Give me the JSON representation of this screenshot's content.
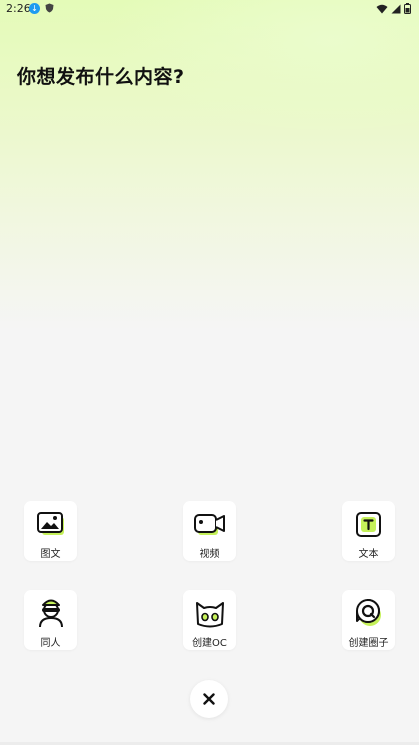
{
  "status_bar": {
    "time": "2:26",
    "badge_glyph": "↓"
  },
  "title": "你想发布什么内容?",
  "items": [
    {
      "label": "图文",
      "icon": "image-icon"
    },
    {
      "label": "视频",
      "icon": "video-icon"
    },
    {
      "label": "文本",
      "icon": "text-icon"
    },
    {
      "label": "同人",
      "icon": "character-icon"
    },
    {
      "label": "创建OC",
      "icon": "cat-icon"
    },
    {
      "label": "创建圈子",
      "icon": "circle-chat-icon"
    }
  ],
  "colors": {
    "accent": "#c5f15a",
    "outline": "#111111",
    "background": "#f5f5f5"
  }
}
